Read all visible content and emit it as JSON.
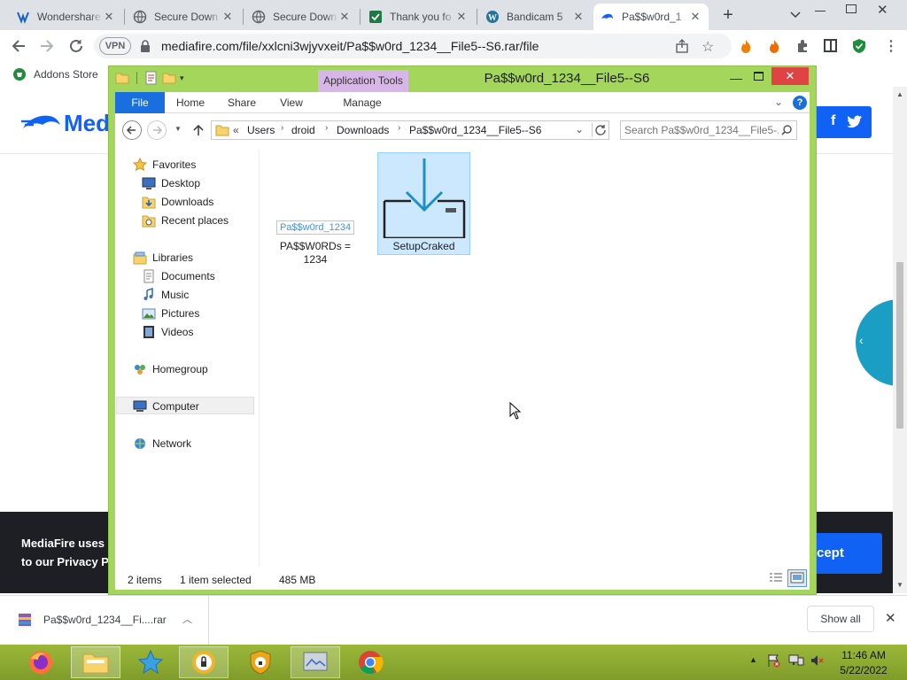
{
  "browser": {
    "tabs": [
      {
        "title": "Wondershare",
        "icon": "wondershare-icon"
      },
      {
        "title": "Secure Down",
        "icon": "globe-icon"
      },
      {
        "title": "Secure Down",
        "icon": "globe-icon"
      },
      {
        "title": "Thank you fo",
        "icon": "green-page-icon"
      },
      {
        "title": "Bandicam 5",
        "icon": "wordpress-icon"
      },
      {
        "title": "Pa$$w0rd_1",
        "icon": "mediafire-icon",
        "active": true
      }
    ],
    "vpn_label": "VPN",
    "url": "mediafire.com/file/xxlcni3wjyvxeit/Pa$$w0rd_1234__File5--S6.rar/file",
    "bookmarks": [
      {
        "label": "Addons Store"
      }
    ]
  },
  "background_page": {
    "logo_text": "Med",
    "cookie_text_line1": "MediaFire uses c",
    "cookie_text_line2": "to our Privacy Po",
    "accept_label": "cept"
  },
  "explorer": {
    "title": "Pa$$w0rd_1234__File5--S6",
    "context_tab": "Application Tools",
    "ribbon_tabs": [
      "File",
      "Home",
      "Share",
      "View",
      "Manage"
    ],
    "breadcrumb": [
      "Users",
      "droid",
      "Downloads",
      "Pa$$w0rd_1234__File5--S6"
    ],
    "breadcrumb_prefix": "«",
    "search_placeholder": "Search Pa$$w0rd_1234__File5-...",
    "nav": {
      "favorites": "Favorites",
      "desktop": "Desktop",
      "downloads": "Downloads",
      "recent": "Recent places",
      "libraries": "Libraries",
      "documents": "Documents",
      "music": "Music",
      "pictures": "Pictures",
      "videos": "Videos",
      "homegroup": "Homegroup",
      "computer": "Computer",
      "network": "Network"
    },
    "files": [
      {
        "name_line1": "PA$$W0RDs =",
        "name_line2": "1234",
        "thumb_text": "Pa$$w0rd_1234",
        "selected": false
      },
      {
        "name_line1": "SetupCraked",
        "selected": true
      }
    ],
    "status": {
      "items": "2 items",
      "selected": "1 item selected",
      "size": "485 MB"
    }
  },
  "download_bar": {
    "file": "Pa$$w0rd_1234__Fi....rar",
    "show_all": "Show all"
  },
  "taskbar": {
    "time": "11:46 AM",
    "date": "5/22/2022"
  },
  "colors": {
    "explorer_frame": "#a3d65b",
    "selection": "#cce8ff",
    "accent_blue": "#1a6fde",
    "mediafire_blue": "#1062f5",
    "close_red": "#e04343",
    "taskbar": "#8caa33"
  }
}
